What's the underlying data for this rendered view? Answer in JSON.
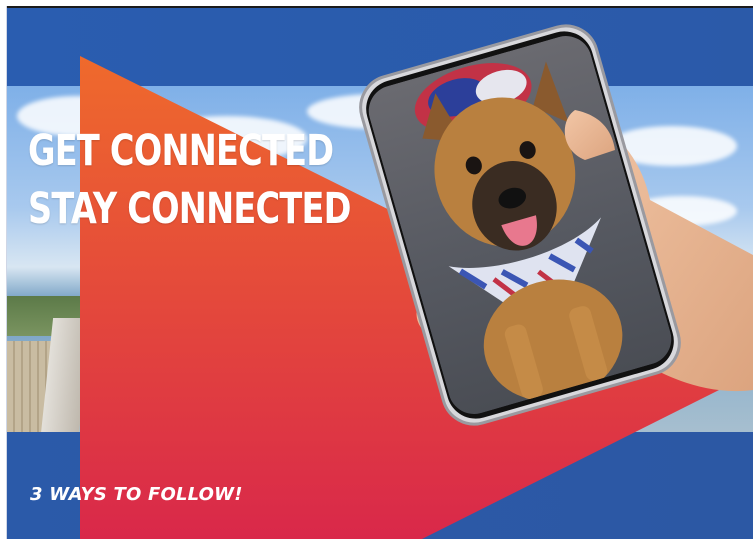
{
  "headline": {
    "line1": "GET CONNECTED",
    "line2": "STAY CONNECTED"
  },
  "tagline": "3 WAYS TO FOLLOW!",
  "colors": {
    "brand_blue": "#2b5aa9",
    "triangle_top": "#ef6a2c",
    "triangle_bottom": "#d9284a",
    "text": "#ffffff"
  },
  "icons": {
    "phone": "smartphone-icon",
    "dog_photo": "dog-photo"
  }
}
